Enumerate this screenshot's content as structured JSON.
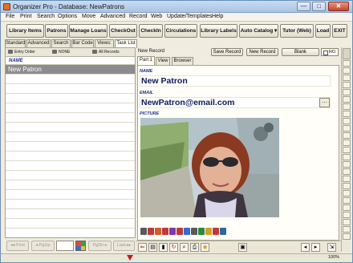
{
  "window": {
    "title": "Organizer Pro - Database: NewPatrons",
    "minimize": "—",
    "maximize": "□",
    "close": "✕"
  },
  "menu": [
    "File",
    "Print",
    "Search",
    "Options",
    "Move",
    "Advanced",
    "Record",
    "Web",
    "Update/Templates",
    "Help"
  ],
  "toolbar": [
    "Library Items",
    "Patrons",
    "Manage Loans",
    "CheckOut",
    "CheckIn",
    "Circulations",
    "Library Labels",
    "Auto Catalog",
    "Tutor (Web)",
    "Load",
    "EXIT"
  ],
  "view_tabs": [
    "Standard",
    "Advanced",
    "Search",
    "Bar Code",
    "Views:",
    "Task List"
  ],
  "sortbar": {
    "entry_order": "Entry Order",
    "none": "NONE",
    "all_records": "All Records"
  },
  "list": {
    "column_header": "NAME",
    "rows": [
      "New Patron"
    ]
  },
  "nav": {
    "first": "First",
    "pgup": "PgUp",
    "pgdn": "PgDn",
    "last": "Last"
  },
  "record": {
    "status": "New Record",
    "save": "Save Record",
    "new": "New Record",
    "blank": "Blank",
    "ro": "RO",
    "tabs": [
      "Part 1",
      "View",
      "Browser"
    ],
    "fields": {
      "name_label": "NAME",
      "name_value": "New Patron",
      "email_label": "EMAIL",
      "email_value": "NewPatron@email.com",
      "picture_label": "PICTURE"
    }
  },
  "status": {
    "zoom": "100%"
  },
  "colors": {
    "accent": "#1b2f8a",
    "selection": "#8c8c8c",
    "window_frame": "#a9c4e6"
  }
}
